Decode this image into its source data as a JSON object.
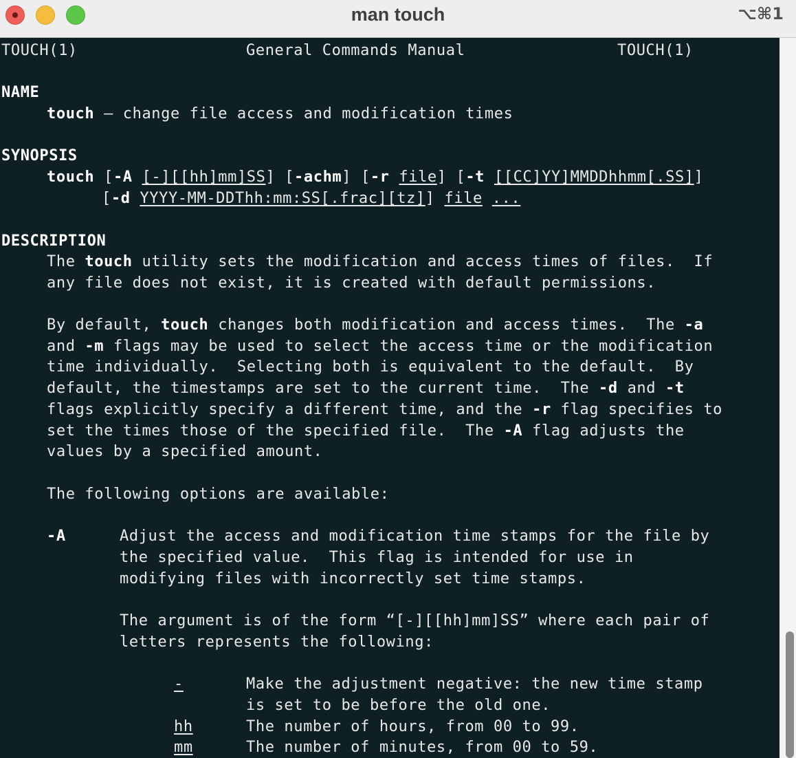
{
  "window": {
    "title": "man touch",
    "shortcut": "⌥⌘1"
  },
  "man": {
    "header": {
      "left": "TOUCH(1)",
      "center": "General Commands Manual",
      "right": "TOUCH(1)"
    },
    "name": {
      "heading": "NAME",
      "cmd": "touch",
      "desc": " – change file access and modification times"
    },
    "synopsis": {
      "heading": "SYNOPSIS",
      "l1_cmd": "touch",
      "l1_a": " [",
      "l1_flagA": "-A",
      "l1_b": " ",
      "l1_argA": "[-][[hh]mm]SS",
      "l1_c": "] [",
      "l1_flags": "-achm",
      "l1_d": "] [",
      "l1_flagr": "-r",
      "l1_e": " ",
      "l1_argr": "file",
      "l1_f": "] [",
      "l1_flagt": "-t",
      "l1_g": " ",
      "l1_argt": "[[CC]YY]MMDDhhmm[.SS]",
      "l1_h": "]",
      "l2_a": "[",
      "l2_flagd": "-d",
      "l2_b": " ",
      "l2_argd": "YYYY-MM-DDThh:mm:SS[.frac][tz]",
      "l2_c": "] ",
      "l2_file": "file",
      "l2_d": " ",
      "l2_dots": "..."
    },
    "description": {
      "heading": "DESCRIPTION",
      "p1_l1_a": "The ",
      "p1_l1_cmd": "touch",
      "p1_l1_b": " utility sets the modification and access times of files.  If",
      "p1_l2": "any file does not exist, it is created with default permissions.",
      "p2_l1_a": "By default, ",
      "p2_l1_cmd": "touch",
      "p2_l1_b": " changes both modification and access times.  The ",
      "p2_l1_flag": "-a",
      "p2_l2_a": "and ",
      "p2_l2_flag": "-m",
      "p2_l2_b": " flags may be used to select the access time or the modification",
      "p2_l3": "time individually.  Selecting both is equivalent to the default.  By",
      "p2_l4_a": "default, the timestamps are set to the current time.  The ",
      "p2_l4_flagd": "-d",
      "p2_l4_b": " and ",
      "p2_l4_flagt": "-t",
      "p2_l5_a": "flags explicitly specify a different time, and the ",
      "p2_l5_flag": "-r",
      "p2_l5_b": " flag specifies to",
      "p2_l6_a": "set the times those of the specified file.  The ",
      "p2_l6_flag": "-A",
      "p2_l6_b": " flag adjusts the",
      "p2_l7": "values by a specified amount.",
      "p3": "The following options are available:"
    },
    "optionA": {
      "flag": "-A",
      "l1": "Adjust the access and modification time stamps for the file by",
      "l2": "the specified value.  This flag is intended for use in",
      "l3": "modifying files with incorrectly set time stamps.",
      "l4": "The argument is of the form “[-][[hh]mm]SS” where each pair of",
      "l5": "letters represents the following:",
      "items": [
        {
          "key": "-",
          "l1": "Make the adjustment negative: the new time stamp",
          "l2": "is set to be before the old one."
        },
        {
          "key": "hh",
          "l1": "The number of hours, from 00 to 99."
        },
        {
          "key": "mm",
          "l1": "The number of minutes, from 00 to 59."
        }
      ]
    }
  }
}
